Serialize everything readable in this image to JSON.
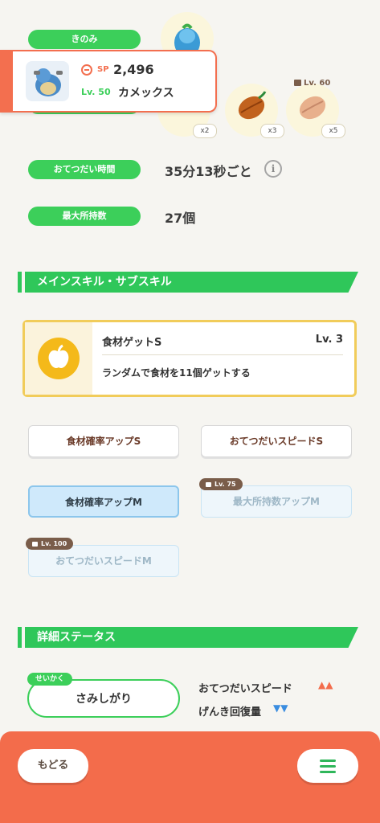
{
  "labels": {
    "berry": "きのみ",
    "help_time": "おてつだい時間",
    "max_carry": "最大所持数"
  },
  "values": {
    "help_time": "35分13秒ごと",
    "max_carry": "27個"
  },
  "pokemon": {
    "sp_label": "SP",
    "sp_value": "2,496",
    "level": "Lv. 50",
    "name": "カメックス"
  },
  "ingredients": [
    {
      "count": "x2"
    },
    {
      "count": "x3"
    },
    {
      "count": "x5",
      "lock_level": "Lv. 60"
    }
  ],
  "sections": {
    "skills": "メインスキル・サブスキル",
    "details": "詳細ステータス"
  },
  "main_skill": {
    "name": "食材ゲットS",
    "level": "Lv. 3",
    "description": "ランダムで食材を11個ゲットする"
  },
  "sub_skills": [
    {
      "label": "食材確率アップS"
    },
    {
      "label": "おてつだいスピードS"
    },
    {
      "label": "食材確率アップM"
    },
    {
      "label": "最大所持数アップM",
      "lock": "Lv. 75"
    },
    {
      "label": "おてつだいスピードM",
      "lock": "Lv. 100"
    }
  ],
  "nature": {
    "tag": "せいかく",
    "name": "さみしがり",
    "up_label": "おてつだいスピード",
    "up_marks": "▲▲",
    "down_label": "げんき回復量",
    "down_marks": "▼▼"
  },
  "footer": {
    "back_label": "もどる"
  },
  "colors": {
    "green": "#3ccf5a",
    "orange": "#f36c4b",
    "gold": "#f1cc5a",
    "up": "#f36c4b",
    "down": "#3a8de0"
  }
}
